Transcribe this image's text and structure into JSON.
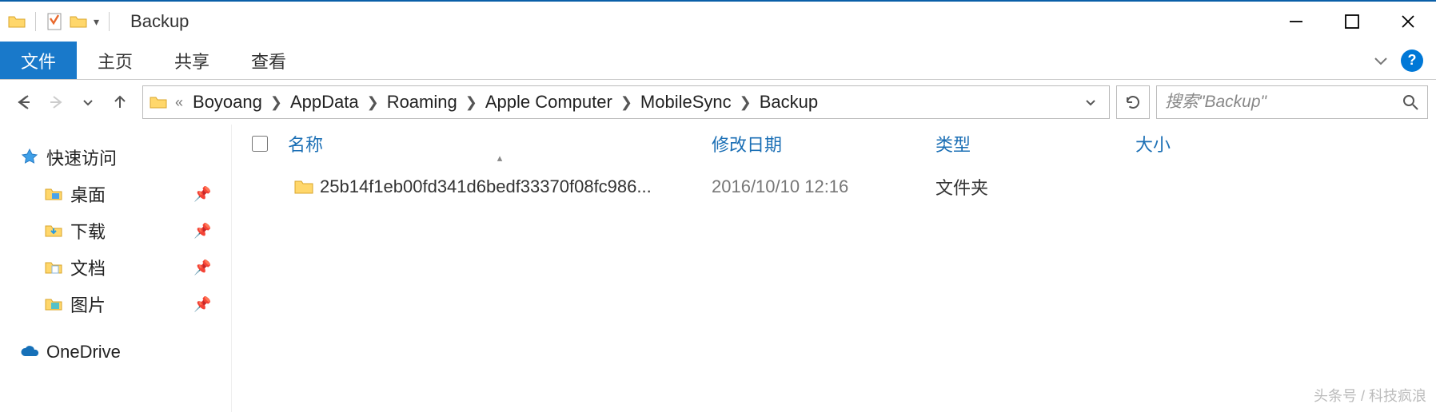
{
  "window": {
    "title": "Backup"
  },
  "ribbon": {
    "tabs": {
      "file": "文件",
      "home": "主页",
      "share": "共享",
      "view": "查看"
    }
  },
  "breadcrumbs": [
    "Boyoang",
    "AppData",
    "Roaming",
    "Apple Computer",
    "MobileSync",
    "Backup"
  ],
  "search": {
    "placeholder": "搜索\"Backup\""
  },
  "sidebar": {
    "quick": "快速访问",
    "items": [
      {
        "label": "桌面"
      },
      {
        "label": "下载"
      },
      {
        "label": "文档"
      },
      {
        "label": "图片"
      }
    ],
    "onedrive": "OneDrive"
  },
  "columns": {
    "name": "名称",
    "date": "修改日期",
    "type": "类型",
    "size": "大小"
  },
  "rows": [
    {
      "name": "25b14f1eb00fd341d6bedf33370f08fc986...",
      "date": "2016/10/10 12:16",
      "type": "文件夹",
      "size": ""
    }
  ],
  "watermark": "头条号 / 科技疯浪"
}
